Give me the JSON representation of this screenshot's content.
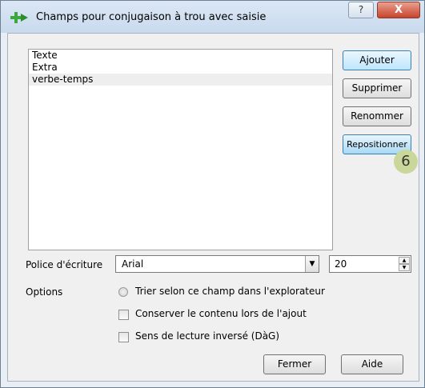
{
  "window": {
    "title": "Champs pour conjugaison à trou avec saisie",
    "help_glyph": "?",
    "close_glyph": "X"
  },
  "fields_list": {
    "items": [
      {
        "label": "Texte",
        "selected": false
      },
      {
        "label": "Extra",
        "selected": false
      },
      {
        "label": "verbe-temps",
        "selected": true
      }
    ]
  },
  "buttons": {
    "add": "Ajouter",
    "delete": "Supprimer",
    "rename": "Renommer",
    "reposition": "Repositionner",
    "close": "Fermer",
    "help": "Aide"
  },
  "step_badge": "6",
  "font": {
    "label": "Police d'écriture",
    "value": "Arial",
    "size": "20"
  },
  "options": {
    "label": "Options",
    "sort_label": "Trier selon ce champ dans l'explorateur",
    "keep_content_label": "Conserver le contenu lors de l'ajout",
    "reverse_reading_label": "Sens de lecture inversé (DàG)"
  },
  "icons": {
    "app": "green-plus-arrow-icon",
    "help": "question-icon",
    "close": "close-icon",
    "dropdown": "chevron-down-icon",
    "spin_up": "spin-up-icon",
    "spin_down": "spin-down-icon"
  },
  "colors": {
    "titlebar": "#c9daee",
    "close_button": "#c8442d",
    "default_button_border": "#3c7fb1",
    "badge": "#c9d79a"
  }
}
